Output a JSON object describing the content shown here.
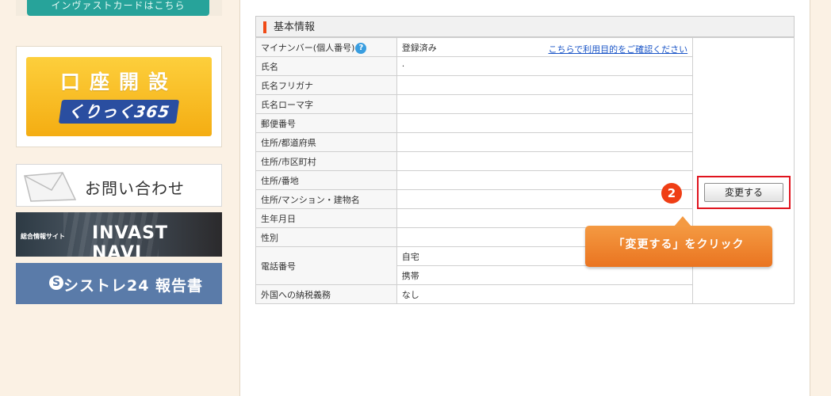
{
  "sidebar": {
    "invest_card": "インヴァストカードはこちら",
    "account_open": {
      "title": "口座開設",
      "logo": "くりっく365"
    },
    "contact": "お問い合わせ",
    "navi": {
      "small": "総合情報サイト",
      "big": "INVAST NAVI"
    },
    "report": {
      "icon": "S",
      "label": "シストレ24 報告書"
    }
  },
  "info": {
    "header": "基本情報",
    "mynumber": {
      "label": "マイナンバー(個人番号)",
      "help": "?",
      "value": "登録済み",
      "link": "こちらで利用目的をご確認ください"
    },
    "rows": [
      {
        "label": "氏名",
        "value": "·"
      },
      {
        "label": "氏名フリガナ",
        "value": ""
      },
      {
        "label": "氏名ローマ字",
        "value": ""
      },
      {
        "label": "郵便番号",
        "value": ""
      },
      {
        "label": "住所/都道府県",
        "value": ""
      },
      {
        "label": "住所/市区町村",
        "value": ""
      },
      {
        "label": "住所/番地",
        "value": ""
      },
      {
        "label": "住所/マンション・建物名",
        "value": ""
      },
      {
        "label": "生年月日",
        "value": ""
      },
      {
        "label": "性別",
        "value": ""
      }
    ],
    "phone": {
      "label": "電話番号",
      "home": "自宅",
      "mobile": "携帯"
    },
    "tax": {
      "label": "外国への納税義務",
      "value": "なし"
    }
  },
  "actions": {
    "change_button": "変更する",
    "step": "2",
    "callout": "「変更する」をクリック"
  },
  "colors": {
    "accent_red": "#e0141e",
    "callout_orange": "#ea7420",
    "link_blue": "#1a55c7"
  }
}
